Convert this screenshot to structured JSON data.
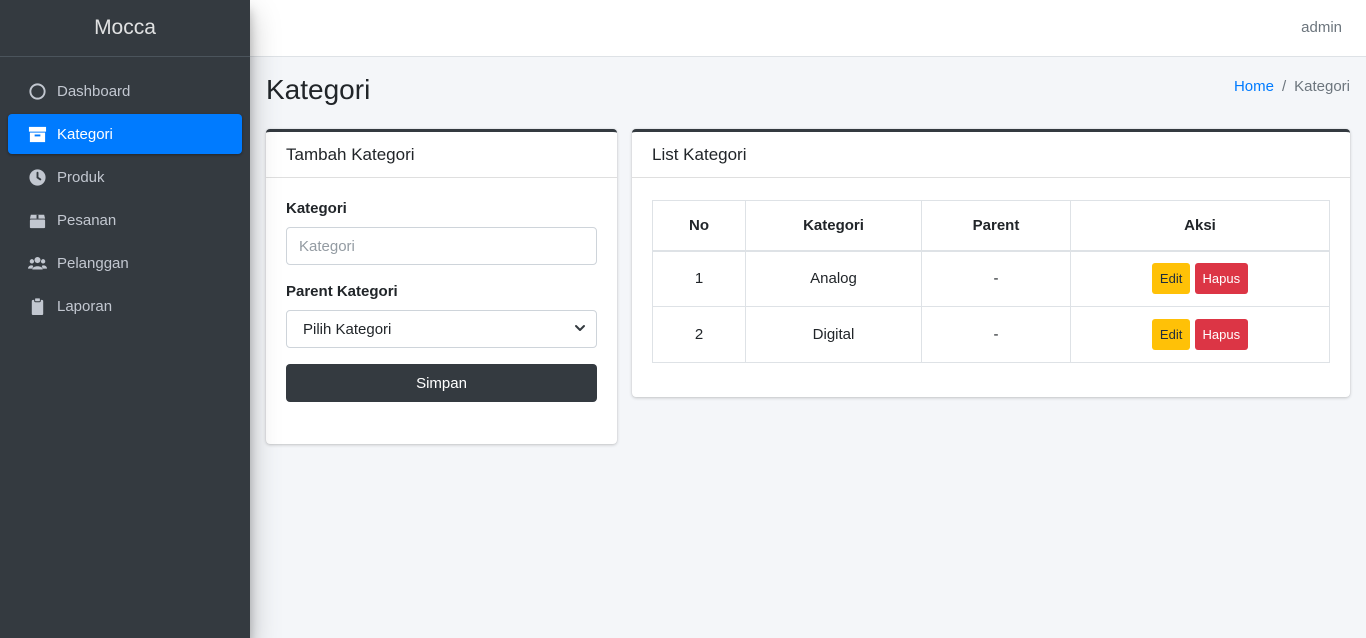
{
  "brand": "Mocca",
  "topbar": {
    "user": "admin"
  },
  "sidebar": {
    "items": [
      {
        "label": "Dashboard",
        "icon": "circle-icon",
        "active": false
      },
      {
        "label": "Kategori",
        "icon": "archive-icon",
        "active": true
      },
      {
        "label": "Produk",
        "icon": "clock-icon",
        "active": false
      },
      {
        "label": "Pesanan",
        "icon": "box-icon",
        "active": false
      },
      {
        "label": "Pelanggan",
        "icon": "users-icon",
        "active": false
      },
      {
        "label": "Laporan",
        "icon": "clipboard-icon",
        "active": false
      }
    ]
  },
  "page": {
    "title": "Kategori",
    "breadcrumb": {
      "home": "Home",
      "separator": "/",
      "current": "Kategori"
    }
  },
  "form": {
    "header": "Tambah Kategori",
    "kategori_label": "Kategori",
    "kategori_placeholder": "Kategori",
    "kategori_value": "",
    "parent_label": "Parent Kategori",
    "parent_selected": "Pilih Kategori",
    "submit_label": "Simpan"
  },
  "list": {
    "header": "List Kategori",
    "columns": [
      "No",
      "Kategori",
      "Parent",
      "Aksi"
    ],
    "rows": [
      {
        "no": "1",
        "kategori": "Analog",
        "parent": "-",
        "edit": "Edit",
        "delete": "Hapus"
      },
      {
        "no": "2",
        "kategori": "Digital",
        "parent": "-",
        "edit": "Edit",
        "delete": "Hapus"
      }
    ]
  },
  "colors": {
    "sidebar_bg": "#343a40",
    "active": "#007bff",
    "warning": "#ffc107",
    "danger": "#dc3545"
  }
}
